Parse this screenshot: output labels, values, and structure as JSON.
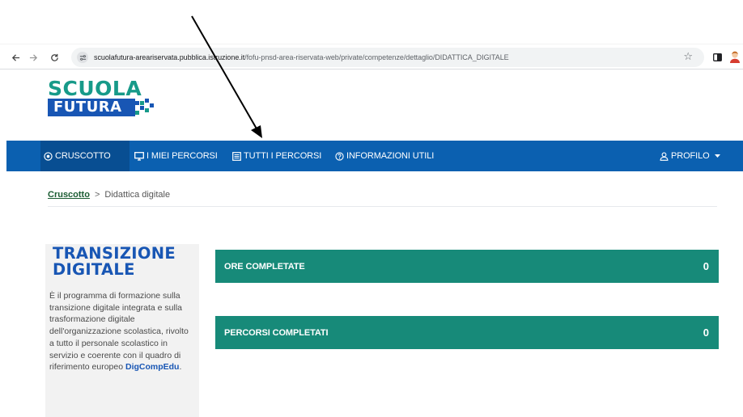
{
  "browser": {
    "url_host": "scuolafutura-areariservata.pubblica.istruzione.it",
    "url_path": "/fofu-pnsd-area-riservata-web/private/competenze/dettaglio/DIDATTICA_DIGITALE",
    "icons": [
      "back-arrow-icon",
      "forward-arrow-icon",
      "reload-icon",
      "site-info-icon",
      "bookmark-star-icon",
      "side-panel-icon",
      "profile-avatar-icon"
    ]
  },
  "logo": {
    "line1": "SCUOLA",
    "line2": "FUTURA",
    "colors": {
      "teal": "#179a89",
      "blue": "#1856b4"
    }
  },
  "nav": {
    "background": "#0b60b0",
    "items": [
      {
        "label": "CRUSCOTTO",
        "icon": "dashboard-icon",
        "active": true
      },
      {
        "label": "I MIEI PERCORSI",
        "icon": "monitor-icon",
        "active": false
      },
      {
        "label": "TUTTI I PERCORSI",
        "icon": "list-icon",
        "active": false
      },
      {
        "label": "INFORMAZIONI UTILI",
        "icon": "help-circle-icon",
        "active": false
      }
    ],
    "profile": {
      "label": "PROFILO",
      "icon": "user-icon",
      "dropdown_icon": "caret-down-icon"
    }
  },
  "breadcrumb": {
    "link": "Cruscotto",
    "separator": ">",
    "current": "Didattica digitale"
  },
  "side_panel": {
    "title_line1": "TRANSIZIONE",
    "title_line2": "DIGITALE",
    "description": "È il programma di formazione sulla transizione digitale integrata e sulla trasformazione digitale dell'organizzazione scolastica, rivolto a tutto il personale scolastico in servizio e coerente con il quadro di riferimento europeo",
    "highlight": "DigCompEdu",
    "end_punct": "."
  },
  "stats": [
    {
      "label": "ORE COMPLETATE",
      "value": "0"
    },
    {
      "label": "PERCORSI COMPLETATI",
      "value": "0"
    }
  ],
  "colors": {
    "stat_bar": "#178a79",
    "nav_active": "#084e92",
    "breadcrumb_link": "#1a5c32",
    "annotation_arrow": "#000000"
  }
}
